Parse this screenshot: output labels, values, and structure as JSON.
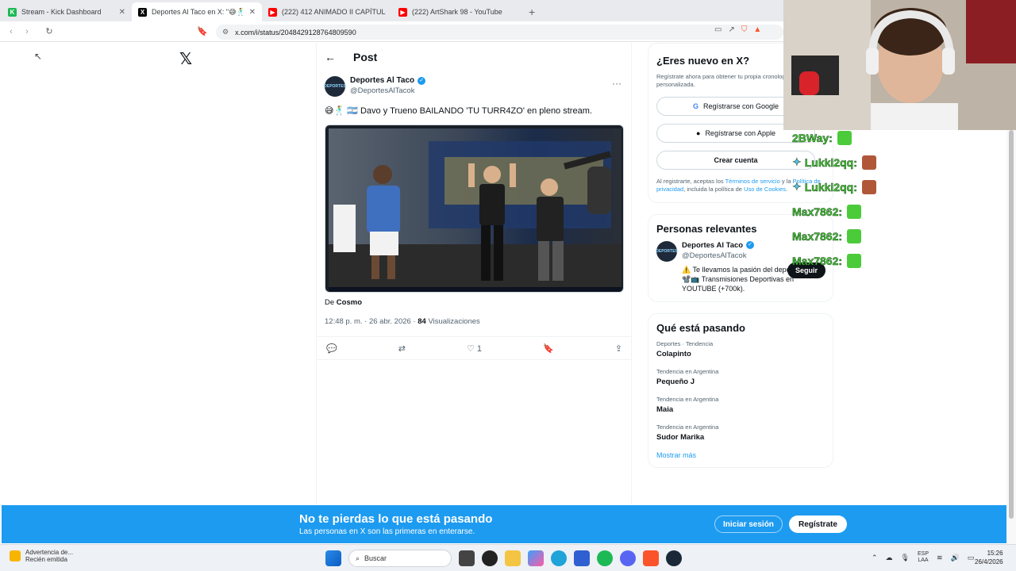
{
  "browser": {
    "tabs": [
      {
        "title": "Stream - Kick Dashboard",
        "favicon_color": "#1db954",
        "favicon_glyph": "K",
        "active": false
      },
      {
        "title": "Deportes Al Taco en X: \"😅🕺 D",
        "favicon_color": "#000000",
        "favicon_glyph": "X",
        "active": true
      },
      {
        "title": "(222) 412 ANIMADO II CAPÍTULO 1 -",
        "favicon_color": "#ff0000",
        "favicon_glyph": "▶",
        "active": false
      },
      {
        "title": "(222) ArtShark 98 - YouTube",
        "favicon_color": "#ff0000",
        "favicon_glyph": "▶",
        "active": false
      }
    ],
    "url": "x.com/i/status/2048429128764809590"
  },
  "post": {
    "header_title": "Post",
    "author_name": "Deportes Al Taco",
    "author_handle": "@DeportesAlTacok",
    "text": "😅🕺 🇦🇷 Davo y Trueno BAILANDO 'TU TURR4ZO' en pleno stream.",
    "from_prefix": "De",
    "from_source": "Cosmo",
    "time": "12:48 p. m. · 26 abr. 2026 ·",
    "views_count": "84",
    "views_label": "Visualizaciones",
    "likes": "1"
  },
  "signup": {
    "title": "¿Eres nuevo en X?",
    "subtitle": "Regístrate ahora para obtener tu propia cronología personalizada.",
    "google": "Regístrarse con Google",
    "apple": "Regístrarse con Apple",
    "create": "Crear cuenta",
    "legal_prefix": "Al registrarte, aceptas los",
    "terms": "Términos de servicio",
    "legal_and": "y la",
    "privacy": "Política de privacidad",
    "legal_mid": ", incluida la política de",
    "cookies": "Uso de Cookies",
    "legal_end": "."
  },
  "relevant": {
    "title": "Personas relevantes",
    "name": "Deportes Al Taco",
    "handle": "@DeportesAlTacok",
    "bio1": "⚠️ Te llevamos la pasión del deporte.",
    "bio2": "📽️📺 Transmisiones Deportivas en YOUTUBE (+700k).",
    "follow": "Seguir"
  },
  "trends": {
    "title": "Qué está pasando",
    "items": [
      {
        "category": "Deportes · Tendencia",
        "name": "Colapinto"
      },
      {
        "category": "Tendencia en Argentina",
        "name": "Pequeño J"
      },
      {
        "category": "Tendencia en Argentina",
        "name": "Maia"
      },
      {
        "category": "Tendencia en Argentina",
        "name": "Sudor Marika"
      }
    ],
    "show_more": "Mostrar más"
  },
  "banner": {
    "title": "No te pierdas lo que está pasando",
    "subtitle": "Las personas en X son las primeras en enterarse.",
    "login": "Iniciar sesión",
    "register": "Regístrate"
  },
  "chat": [
    {
      "user": "2BWay:"
    },
    {
      "user": "Lukki2qq:"
    },
    {
      "user": "Lukki2qq:"
    },
    {
      "user": "Max7862:"
    },
    {
      "user": "Max7862:"
    },
    {
      "user": "Max7862:"
    }
  ],
  "taskbar": {
    "notif_title": "Advertencia de...",
    "notif_sub": "Recién emitida",
    "search": "Buscar",
    "lang_top": "ESP",
    "lang_bottom": "LAA",
    "time": "15:26",
    "date": "26/4/2026"
  },
  "colors": {
    "accent": "#1d9bf0",
    "chat_green": "#4ccb3a"
  }
}
